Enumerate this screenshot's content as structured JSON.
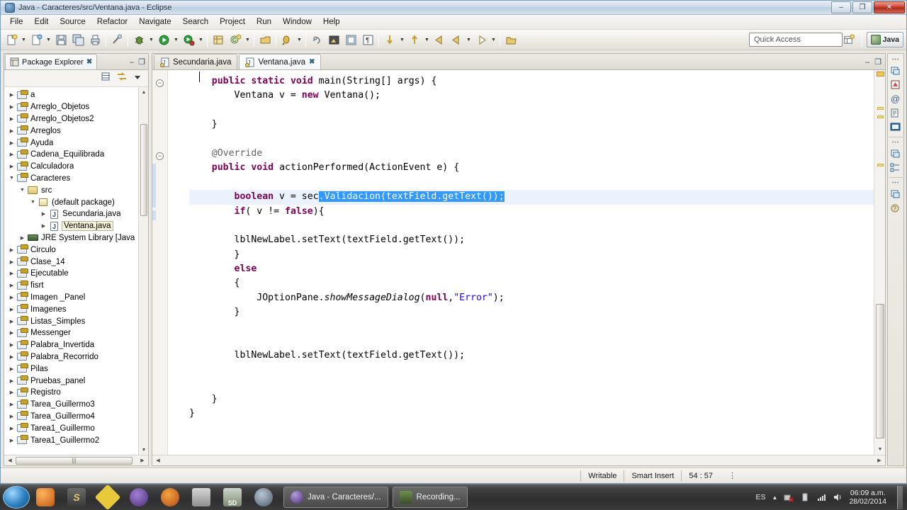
{
  "window": {
    "title": "Java - Caracteres/src/Ventana.java - Eclipse",
    "minimize_label": "–",
    "maximize_label": "❐",
    "close_label": "✕"
  },
  "menubar": {
    "items": [
      {
        "label": "File"
      },
      {
        "label": "Edit"
      },
      {
        "label": "Source"
      },
      {
        "label": "Refactor"
      },
      {
        "label": "Navigate"
      },
      {
        "label": "Search"
      },
      {
        "label": "Project"
      },
      {
        "label": "Run"
      },
      {
        "label": "Window"
      },
      {
        "label": "Help"
      }
    ]
  },
  "toolbar": {
    "icons": [
      {
        "name": "new-wizard-icon",
        "dropdown": true
      },
      {
        "name": "new-java-class-icon",
        "dropdown": true
      },
      {
        "name": "save-icon",
        "dropdown": false
      },
      {
        "name": "save-all-icon",
        "dropdown": false
      },
      {
        "name": "print-icon",
        "dropdown": false
      },
      {
        "name": "toggle-mark-occurrences-icon",
        "dropdown": false
      },
      {
        "name": "debug-icon",
        "dropdown": true
      },
      {
        "name": "run-icon",
        "dropdown": true
      },
      {
        "name": "run-external-tools-icon",
        "dropdown": true
      },
      {
        "name": "new-java-project-icon",
        "dropdown": false
      },
      {
        "name": "open-type-icon",
        "dropdown": true
      },
      {
        "name": "open-task-icon",
        "dropdown": false
      },
      {
        "name": "search-icon",
        "dropdown": true
      },
      {
        "name": "toggle-breadcrumb-icon",
        "dropdown": false
      },
      {
        "name": "toggle-block-selection-icon",
        "dropdown": false
      },
      {
        "name": "show-whitespace-icon",
        "dropdown": false
      },
      {
        "name": "next-annotation-icon",
        "dropdown": true
      },
      {
        "name": "previous-annotation-icon",
        "dropdown": true
      },
      {
        "name": "back-icon",
        "dropdown": false
      },
      {
        "name": "forward-icon",
        "dropdown": true
      },
      {
        "name": "last-edit-location-icon",
        "dropdown": true
      },
      {
        "name": "open-perspective-icon",
        "dropdown": false
      }
    ],
    "quick_access_placeholder": "Quick Access",
    "quick_access_value": "",
    "open_perspective_title": "Open Perspective",
    "perspective_label": "Java"
  },
  "explorer": {
    "tab_label": "Package Explorer",
    "tab_close": "✖",
    "minimize_label": "–",
    "maximize_label": "❐",
    "collapse_all_icon": "collapse-all-icon",
    "link_with_editor_icon": "link-with-editor-icon",
    "view_menu_icon": "view-menu-icon",
    "tree": [
      {
        "label": "a",
        "indent": 0,
        "icon": "java-project",
        "twisty": "collapsed"
      },
      {
        "label": "Arreglo_Objetos",
        "indent": 0,
        "icon": "java-project",
        "twisty": "collapsed"
      },
      {
        "label": "Arreglo_Objetos2",
        "indent": 0,
        "icon": "java-project",
        "twisty": "collapsed"
      },
      {
        "label": "Arreglos",
        "indent": 0,
        "icon": "java-project",
        "twisty": "collapsed"
      },
      {
        "label": "Ayuda",
        "indent": 0,
        "icon": "java-project",
        "twisty": "collapsed"
      },
      {
        "label": "Cadena_Equilibrada",
        "indent": 0,
        "icon": "java-project",
        "twisty": "collapsed"
      },
      {
        "label": "Calculadora",
        "indent": 0,
        "icon": "java-project",
        "twisty": "collapsed"
      },
      {
        "label": "Caracteres",
        "indent": 0,
        "icon": "java-project",
        "twisty": "expanded"
      },
      {
        "label": "src",
        "indent": 1,
        "icon": "source-folder",
        "twisty": "expanded"
      },
      {
        "label": "(default package)",
        "indent": 2,
        "icon": "package",
        "twisty": "expanded"
      },
      {
        "label": "Secundaria.java",
        "indent": 3,
        "icon": "java-file",
        "twisty": "collapsed"
      },
      {
        "label": "Ventana.java",
        "indent": 3,
        "icon": "java-file",
        "twisty": "collapsed",
        "selected": true
      },
      {
        "label": "JRE System Library [Java",
        "indent": 1,
        "icon": "jre-library",
        "twisty": "collapsed"
      },
      {
        "label": "Circulo",
        "indent": 0,
        "icon": "java-project",
        "twisty": "collapsed"
      },
      {
        "label": "Clase_14",
        "indent": 0,
        "icon": "java-project",
        "twisty": "collapsed"
      },
      {
        "label": "Ejecutable",
        "indent": 0,
        "icon": "java-project",
        "twisty": "collapsed"
      },
      {
        "label": "fisrt",
        "indent": 0,
        "icon": "java-project",
        "twisty": "collapsed"
      },
      {
        "label": "Imagen _Panel",
        "indent": 0,
        "icon": "java-project",
        "twisty": "collapsed"
      },
      {
        "label": "Imagenes",
        "indent": 0,
        "icon": "java-project",
        "twisty": "collapsed"
      },
      {
        "label": "Listas_Simples",
        "indent": 0,
        "icon": "java-project",
        "twisty": "collapsed"
      },
      {
        "label": "Messenger",
        "indent": 0,
        "icon": "java-project",
        "twisty": "collapsed"
      },
      {
        "label": "Palabra_Invertida",
        "indent": 0,
        "icon": "java-project",
        "twisty": "collapsed"
      },
      {
        "label": "Palabra_Recorrido",
        "indent": 0,
        "icon": "java-project",
        "twisty": "collapsed"
      },
      {
        "label": "Pilas",
        "indent": 0,
        "icon": "java-project",
        "twisty": "collapsed"
      },
      {
        "label": "Pruebas_panel",
        "indent": 0,
        "icon": "java-project",
        "twisty": "collapsed"
      },
      {
        "label": "Registro",
        "indent": 0,
        "icon": "java-project",
        "twisty": "collapsed"
      },
      {
        "label": "Tarea_Guillermo3",
        "indent": 0,
        "icon": "java-project",
        "twisty": "collapsed"
      },
      {
        "label": "Tarea_Guillermo4",
        "indent": 0,
        "icon": "java-project",
        "twisty": "collapsed"
      },
      {
        "label": "Tarea1_Guillermo",
        "indent": 0,
        "icon": "java-project",
        "twisty": "collapsed"
      },
      {
        "label": "Tarea1_Guillermo2",
        "indent": 0,
        "icon": "java-project",
        "twisty": "collapsed"
      }
    ]
  },
  "editor": {
    "tabs": [
      {
        "label": "Secundaria.java",
        "active": false,
        "close": ""
      },
      {
        "label": "Ventana.java",
        "active": true,
        "close": "✖"
      }
    ],
    "minimize_label": "–",
    "maximize_label": "❐",
    "code_lines": [
      {
        "indent": 4,
        "text": "public static void main(String[] args) {",
        "fold": true
      },
      {
        "indent": 8,
        "text": "Ventana v = new Ventana();"
      },
      {
        "indent": 0,
        "text": ""
      },
      {
        "indent": 4,
        "text": "}"
      },
      {
        "indent": 0,
        "text": ""
      },
      {
        "indent": 4,
        "text": "@Override",
        "fold": true
      },
      {
        "indent": 4,
        "text": "public void actionPerformed(ActionEvent e) {"
      },
      {
        "indent": 0,
        "text": ""
      },
      {
        "indent": 8,
        "text": "boolean v = sec.Validacion(textField.getText());",
        "highlight": true
      },
      {
        "indent": 8,
        "text": "if( v != false){"
      },
      {
        "indent": 0,
        "text": ""
      },
      {
        "indent": 8,
        "text": "lblNewLabel.setText(textField.getText());"
      },
      {
        "indent": 8,
        "text": "}"
      },
      {
        "indent": 8,
        "text": "else"
      },
      {
        "indent": 8,
        "text": "{"
      },
      {
        "indent": 12,
        "text": "JOptionPane.showMessageDialog(null,\"Error\");"
      },
      {
        "indent": 8,
        "text": "}"
      },
      {
        "indent": 0,
        "text": ""
      },
      {
        "indent": 0,
        "text": ""
      },
      {
        "indent": 8,
        "text": "lblNewLabel.setText(textField.getText());"
      },
      {
        "indent": 0,
        "text": ""
      },
      {
        "indent": 0,
        "text": ""
      },
      {
        "indent": 4,
        "text": "}"
      },
      {
        "indent": 0,
        "text": "}"
      }
    ],
    "selection_text": ".Validacion(textField.getText());"
  },
  "fastview": {
    "icons": [
      {
        "name": "restore-view-icon"
      },
      {
        "name": "problems-view-icon"
      },
      {
        "name": "javadoc-view-icon"
      },
      {
        "name": "declaration-view-icon"
      },
      {
        "name": "console-view-icon"
      },
      {
        "name": "restore-view-icon-2"
      },
      {
        "name": "outline-view-icon"
      },
      {
        "name": "restore-view-icon-3"
      },
      {
        "name": "task-list-view-icon"
      }
    ]
  },
  "statusbar": {
    "writable": "Writable",
    "insert_mode": "Smart Insert",
    "position": "54 : 57",
    "more": "⋮"
  },
  "taskbar": {
    "start_label": "start-orb",
    "quick_icons": [
      {
        "name": "media-player-icon"
      },
      {
        "name": "sublime-icon"
      },
      {
        "name": "netbeans-icon"
      },
      {
        "name": "opera-icon"
      },
      {
        "name": "office-icon"
      },
      {
        "name": "installer-icon"
      },
      {
        "name": "sd-formatter-icon"
      },
      {
        "name": "camtasia-icon"
      }
    ],
    "windows": [
      {
        "label": "Java - Caracteres/...",
        "icon": "eclipse-icon",
        "active": true
      },
      {
        "label": "Recording...",
        "icon": "camtasia-recorder-icon",
        "active": false
      }
    ],
    "tray": {
      "language": "ES",
      "show_hidden": "▲",
      "icons": [
        {
          "name": "network-error-icon"
        },
        {
          "name": "battery-icon"
        },
        {
          "name": "signal-icon"
        },
        {
          "name": "volume-icon"
        }
      ],
      "time": "06:09 a.m.",
      "date": "28/02/2014"
    }
  },
  "colors": {
    "keyword": "#7f0055",
    "string": "#2a00ff",
    "selection": "#3399ff",
    "highlight_line": "#eaf2fd",
    "annotation": "#646464"
  }
}
